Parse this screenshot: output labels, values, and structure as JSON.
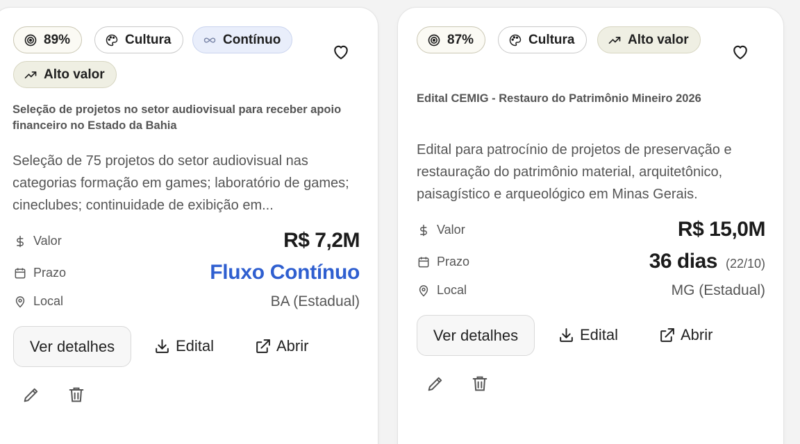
{
  "cards": [
    {
      "badges": {
        "score": "89%",
        "category": "Cultura",
        "type": "Contínuo",
        "value_tag": "Alto valor"
      },
      "subtitle": "Seleção de projetos no setor audiovisual para receber apoio financeiro no Estado da Bahia",
      "description": "Seleção de 75 projetos do setor audiovisual nas categorias formação em games; laboratório de games; cineclubes; continuidade de exibição em...",
      "rows": {
        "valor_label": "Valor",
        "valor": "R$ 7,2M",
        "prazo_label": "Prazo",
        "prazo": "Fluxo Contínuo",
        "local_label": "Local",
        "local": "BA (Estadual)"
      },
      "actions": {
        "details": "Ver detalhes",
        "edital": "Edital",
        "abrir": "Abrir"
      }
    },
    {
      "badges": {
        "score": "87%",
        "category": "Cultura",
        "value_tag": "Alto valor"
      },
      "subtitle": "Edital CEMIG - Restauro do Patrimônio Mineiro 2026",
      "description": "Edital para patrocínio de projetos de preservação e restauração do patrimônio material, arquitetônico, paisagístico e arqueológico em Minas Gerais.",
      "rows": {
        "valor_label": "Valor",
        "valor": "R$ 15,0M",
        "prazo_label": "Prazo",
        "prazo": "36 dias",
        "prazo_date": "(22/10)",
        "local_label": "Local",
        "local": "MG (Estadual)"
      },
      "actions": {
        "details": "Ver detalhes",
        "edital": "Edital",
        "abrir": "Abrir"
      }
    }
  ],
  "colors": {
    "accent_blue": "#2f5fd0",
    "card_bg": "#ffffff",
    "page_bg": "#f3f3f3"
  }
}
